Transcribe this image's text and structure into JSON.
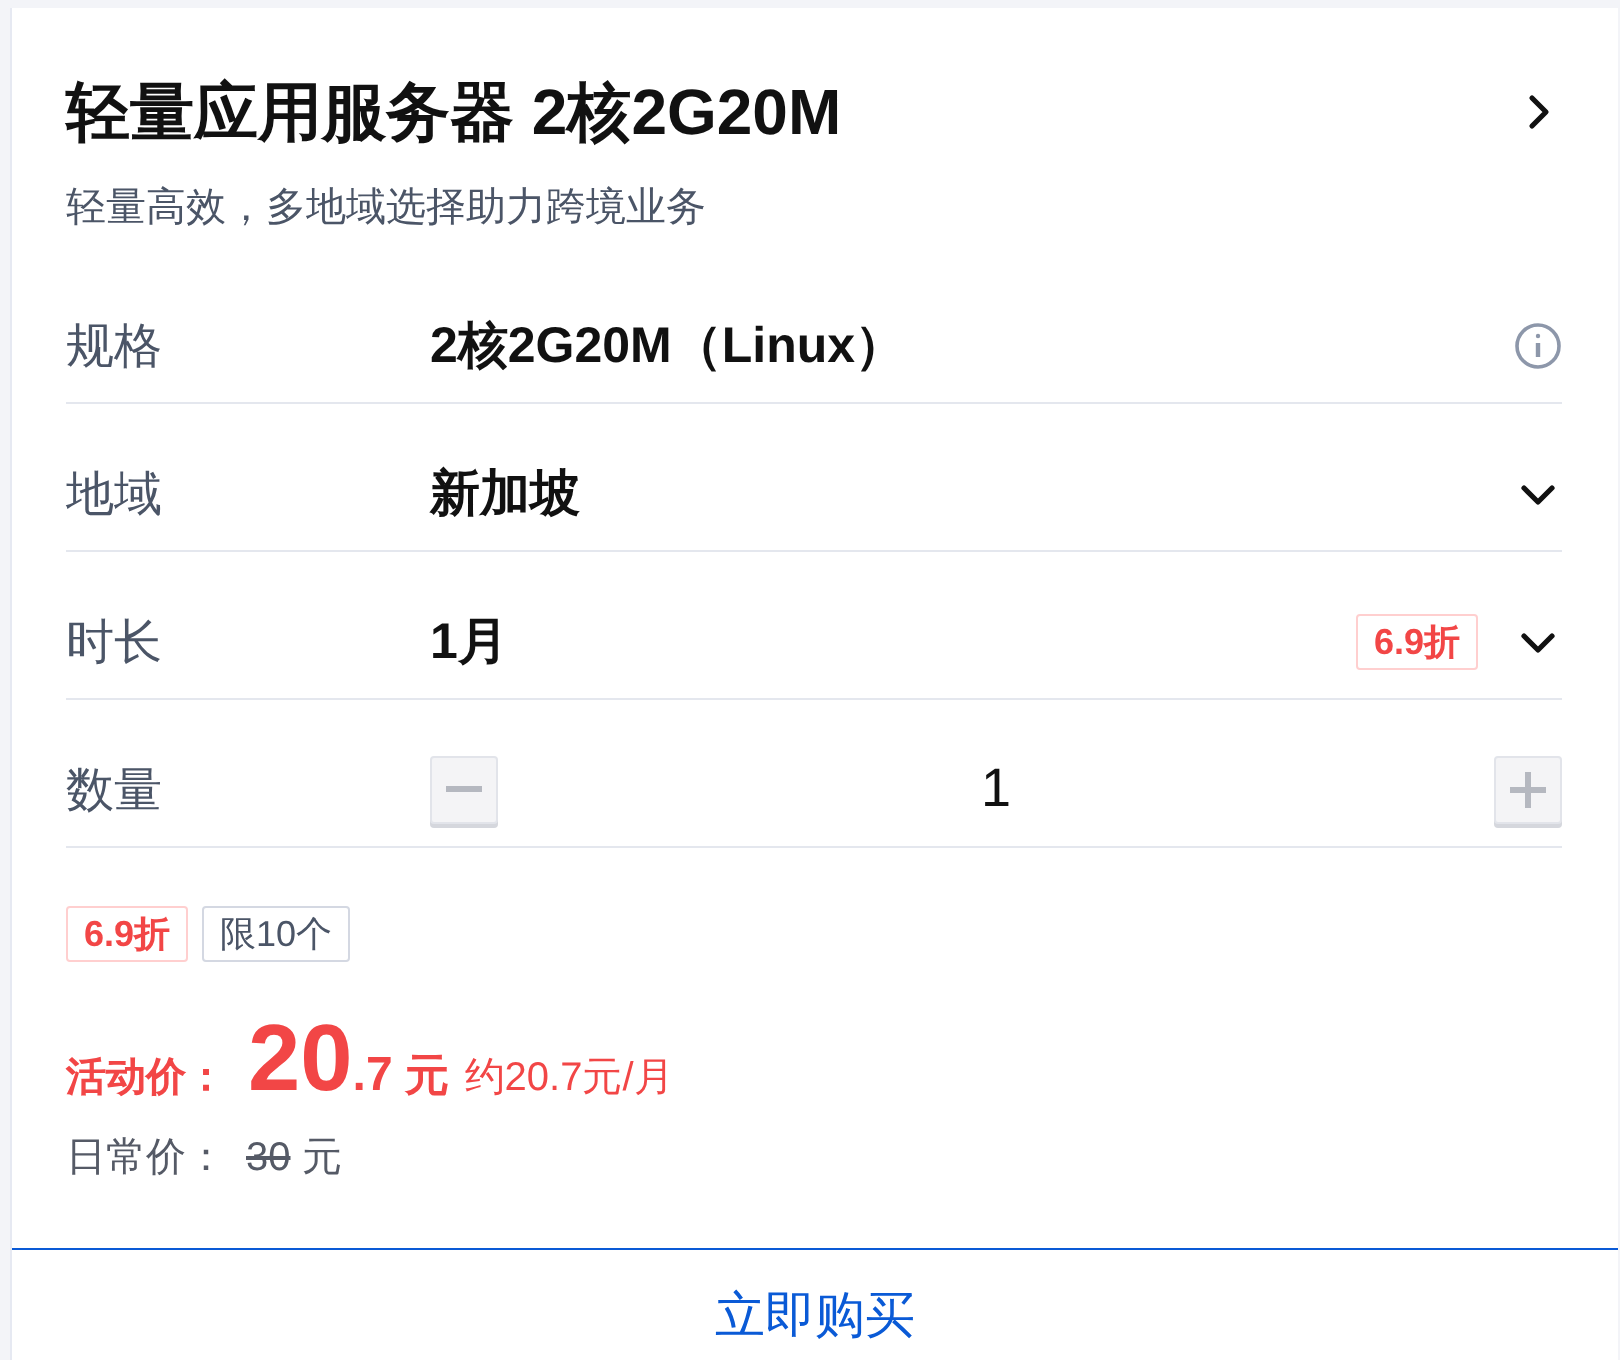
{
  "product": {
    "title": "轻量应用服务器 2核2G20M",
    "subtitle": "轻量高效，多地域选择助力跨境业务"
  },
  "fields": [
    {
      "kind": "info",
      "label": "规格",
      "value": "2核2G20M（Linux）"
    },
    {
      "kind": "select",
      "label": "地域",
      "value": "新加坡"
    },
    {
      "kind": "select",
      "label": "时长",
      "value": "1月",
      "badge": "6.9折"
    },
    {
      "kind": "stepper",
      "label": "数量",
      "value": "1"
    }
  ],
  "tags": [
    {
      "kind": "discount",
      "text": "6.9折"
    },
    {
      "kind": "limit",
      "text": "限10个"
    }
  ],
  "price": {
    "label": "活动价：",
    "integer": "20",
    "decimal": ".7",
    "unit": "元",
    "monthly": "约20.7元/月"
  },
  "regular_price": {
    "label": "日常价：",
    "amount": "30",
    "unit": "元"
  },
  "buy_button": "立即购买"
}
